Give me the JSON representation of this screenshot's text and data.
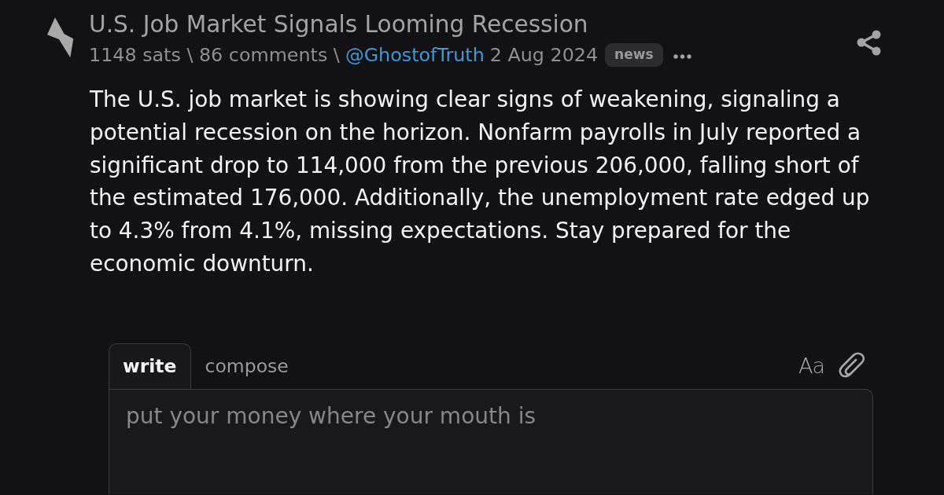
{
  "post": {
    "title": "U.S. Job Market Signals Looming Recession",
    "stats": "1148 sats \\ 86 comments \\",
    "author": "@GhostofTruth",
    "date": "2 Aug 2024",
    "tag": "news",
    "body": "The U.S. job market is showing clear signs of weakening, signaling a potential recession on the horizon. Nonfarm payrolls in July reported a significant drop to 114,000 from the previous 206,000, falling short of the estimated 176,000. Additionally, the unemployment rate edged up to 4.3% from 4.1%, missing expectations. Stay prepared for the economic downturn."
  },
  "reply": {
    "tabs": [
      {
        "label": "write",
        "selected": true
      },
      {
        "label": "compose",
        "selected": false
      }
    ],
    "format_button": "Aa",
    "placeholder": "put your money where your mouth is"
  }
}
